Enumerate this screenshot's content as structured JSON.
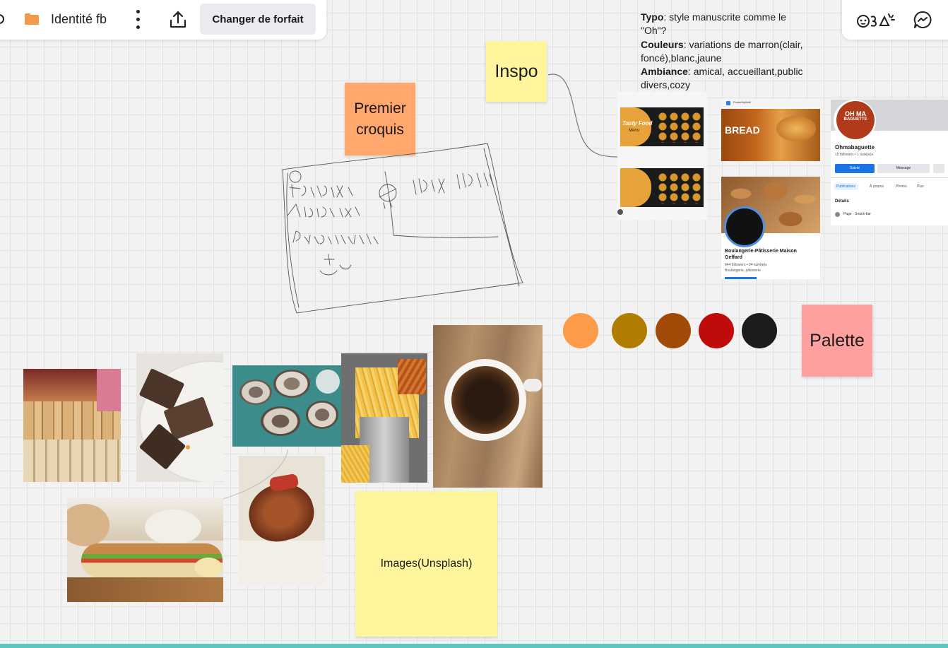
{
  "toolbar": {
    "board_title": "Identité fb",
    "plan_button": "Changer de forfait",
    "folder_color": "#f2994a"
  },
  "notes": {
    "text": {
      "typo_label": "Typo",
      "typo_value": ": style manuscrite comme le \"Oh\"?",
      "colors_label": "Couleurs",
      "colors_value": ": variations de marron(clair, foncé),blanc,jaune",
      "mood_label": "Ambiance",
      "mood_value": ": amical, accueillant,public divers,cozy"
    },
    "inspo": "Inspo",
    "croquis": "Premier croquis",
    "palette_label": "Palette",
    "images_label": "Images(Unsplash)"
  },
  "sketch_text": {
    "left": "Potages Ambour Patisserie Jus",
    "right": "Prix"
  },
  "palette": {
    "colors": [
      "#fd9b48",
      "#b07d00",
      "#a24b09",
      "#bf0b0b",
      "#1c1c1c"
    ]
  },
  "inspo_cards": {
    "menu_title": "Tasty Food",
    "menu_subtitle": "Menu",
    "bread_app": "PosterMyWall",
    "bread_title": "BREAD",
    "ohma_logo_line1": "OH MA",
    "ohma_logo_line2": "BAGUETTE",
    "ohma_name": "Ohmabaguette",
    "ohma_stats": "19 followers • 1 suivi(e)s",
    "ohma_follow": "Suivre",
    "ohma_message": "Message",
    "ohma_tab1": "Publications",
    "ohma_tab2": "À propos",
    "ohma_tab3": "Photos",
    "ohma_tab4": "Plus",
    "ohma_details": "Détails",
    "ohma_page": "Page · Snack-bar",
    "geffard_name": "Boulangerie-Pâtisserie Maison Geffard",
    "geffard_stats": "644 followers • 24 suivi(e)s",
    "geffard_type": "Boulangerie, pâtisserie"
  }
}
